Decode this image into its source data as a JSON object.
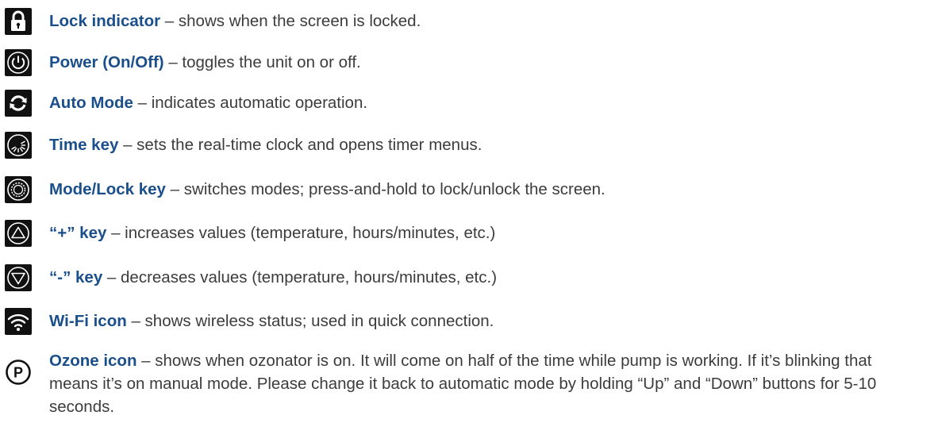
{
  "items": [
    {
      "term": "Lock indicator",
      "desc": " – shows when the screen is locked.",
      "icon": "lock-icon"
    },
    {
      "term": "Power (On/Off)",
      "desc": " – toggles the unit on or off.",
      "icon": "power-icon"
    },
    {
      "term": "Auto Mode",
      "desc": " – indicates automatic operation.",
      "icon": "auto-mode-icon"
    },
    {
      "term": "Time key",
      "desc": " – sets the real-time clock and opens timer menus.",
      "icon": "time-key-icon"
    },
    {
      "term": "Mode/Lock key",
      "desc": " – switches modes; press-and-hold to lock/unlock the screen.",
      "icon": "mode-lock-key-icon"
    },
    {
      "term": "“+” key",
      "desc": " – increases values (temperature, hours/minutes, etc.)",
      "icon": "plus-key-icon"
    },
    {
      "term": "“-” key",
      "desc": " – decreases values (temperature, hours/minutes, etc.)",
      "icon": "minus-key-icon"
    },
    {
      "term": "Wi-Fi icon",
      "desc": " – shows wireless status; used in quick connection.",
      "icon": "wifi-icon"
    },
    {
      "term": "Ozone icon",
      "desc": " – shows when ozonator is on. It will come on half of the time while pump is working. If it’s blinking that means it’s on manual mode. Please change it back to automatic mode by holding “Up” and “Down” buttons for 5-10 seconds.",
      "icon": "ozone-p-icon"
    }
  ],
  "colors": {
    "term": "#1a4f8c",
    "text": "#3c3c3c",
    "icon_bg": "#111111"
  }
}
